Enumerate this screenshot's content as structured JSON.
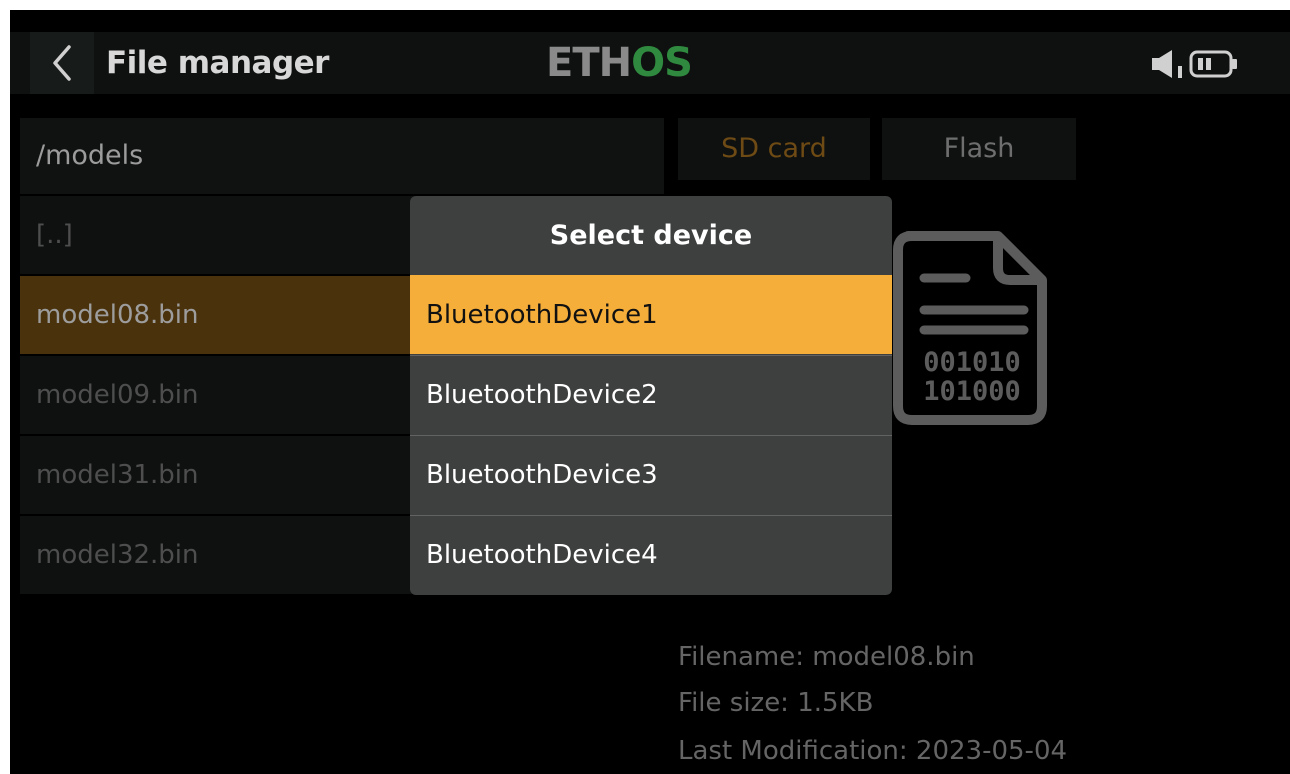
{
  "header": {
    "title": "File manager",
    "logo_part1": "ETH",
    "logo_part2": "OS",
    "back_icon": "chevron-left-icon",
    "status_icons": [
      "speaker-icon",
      "battery-icon"
    ]
  },
  "browser": {
    "path": "/models",
    "items": [
      {
        "label": "[..]",
        "selected": false
      },
      {
        "label": "model08.bin",
        "selected": true
      },
      {
        "label": "model09.bin",
        "selected": false
      },
      {
        "label": "model31.bin",
        "selected": false
      },
      {
        "label": "model32.bin",
        "selected": false
      }
    ]
  },
  "storage_tabs": [
    {
      "label": "SD card",
      "active": true
    },
    {
      "label": "Flash",
      "active": false
    }
  ],
  "preview": {
    "icon": "binary-file-icon",
    "icon_line1": "001010",
    "icon_line2": "101000"
  },
  "file_info": {
    "filename": "Filename: model08.bin",
    "size": "File size: 1.5KB",
    "modified": "Last Modification: 2023-05-04"
  },
  "dialog": {
    "title": "Select device",
    "items": [
      {
        "label": "BluetoothDevice1",
        "selected": true
      },
      {
        "label": "BluetoothDevice2",
        "selected": false
      },
      {
        "label": "BluetoothDevice3",
        "selected": false
      },
      {
        "label": "BluetoothDevice4",
        "selected": false
      }
    ]
  },
  "colors": {
    "accent": "#f5ae3a",
    "selected_row_dim": "#4a320c",
    "logo_green": "#2f8a3f",
    "dialog_bg": "#3e3f3f"
  }
}
